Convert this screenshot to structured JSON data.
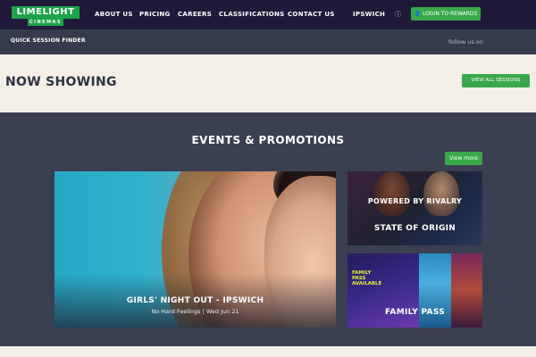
{
  "brand": {
    "logo_main": "LIMELIGHT",
    "logo_sub": "CINEMAS"
  },
  "nav": {
    "items": [
      {
        "label": "ABOUT US"
      },
      {
        "label": "PRICING"
      },
      {
        "label": "CAREERS"
      },
      {
        "label": "CLASSIFICATIONS"
      },
      {
        "label": "CONTACT US"
      },
      {
        "label": "IPSWICH"
      }
    ],
    "login_label": "LOGIN TO REWARDS"
  },
  "quickbar": {
    "finder_label": "QUICK SESSION FINDER",
    "follow_label": "follow us on"
  },
  "now_showing": {
    "title": "NOW SHOWING",
    "button_label": "VIEW ALL SESSIONS"
  },
  "events": {
    "title": "EVENTS & PROMOTIONS",
    "view_more_label": "View more",
    "main_promo": {
      "title": "GIRLS' NIGHT OUT - IPSWICH",
      "subtitle": "No Hard Feelings | Wed Jun 21"
    },
    "side_promos": [
      {
        "overlay": "POWERED    BY RIVALRY",
        "title": "STATE OF ORIGIN"
      },
      {
        "badge": [
          "FAMILY",
          "PASS",
          "AVAILABLE"
        ],
        "title": "FAMILY PASS"
      }
    ]
  },
  "colors": {
    "nav_bg": "#1f1a3a",
    "accent_green": "#3aa84a",
    "cream": "#f3efe7",
    "section_bg": "#3b3f52"
  }
}
